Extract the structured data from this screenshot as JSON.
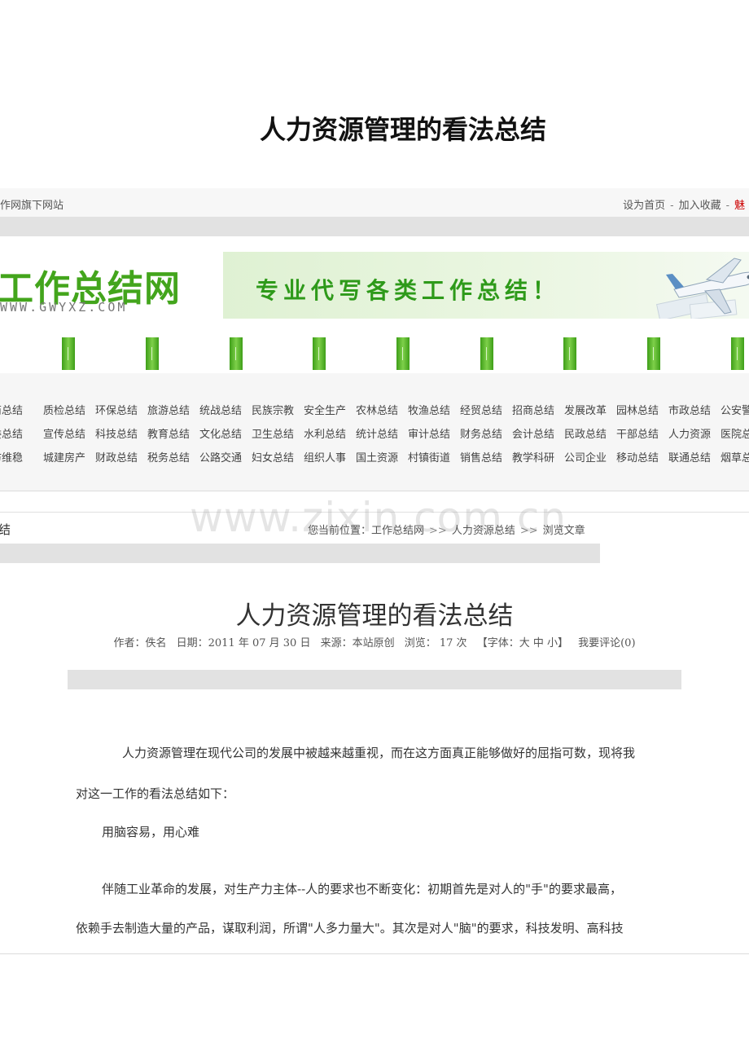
{
  "document_title": "人力资源管理的看法总结",
  "topbar": {
    "left_text": "作网旗下网站",
    "links": [
      "设为首页",
      "加入收藏"
    ],
    "separator": "-",
    "more_fragment": "魅"
  },
  "logo": {
    "name": "工作总结网",
    "url": "WWW.GWYXZ.COM"
  },
  "banner": {
    "text": "专业代写各类工作总结！",
    "icon": "airplane-icon"
  },
  "nav_tabs_count": 9,
  "categories": [
    [
      "商总结",
      "质检总结",
      "环保总结",
      "旅游总结",
      "统战总结",
      "民族宗教",
      "安全生产",
      "农林总结",
      "牧渔总结",
      "经贸总结",
      "招商总结",
      "发展改革",
      "园林总结",
      "市政总结",
      "公安警"
    ],
    [
      "委总结",
      "宣传总结",
      "科技总结",
      "教育总结",
      "文化总结",
      "卫生总结",
      "水利总结",
      "统计总结",
      "审计总结",
      "财务总结",
      "会计总结",
      "民政总结",
      "干部总结",
      "人力资源",
      "医院总"
    ],
    [
      "访维稳",
      "城建房产",
      "财政总结",
      "税务总结",
      "公路交通",
      "妇女总结",
      "组织人事",
      "国土资源",
      "村镇街道",
      "销售总结",
      "教学科研",
      "公司企业",
      "移动总结",
      "联通总结",
      "烟草总"
    ]
  ],
  "section_tag": "结",
  "breadcrumb": {
    "prefix": "您当前位置：",
    "items": [
      "工作总结网",
      "人力资源总结",
      "浏览文章"
    ],
    "separator": ">>"
  },
  "watermark": "www.zixin.com.cn",
  "article": {
    "title": "人力资源管理的看法总结",
    "meta": {
      "author": "作者：佚名",
      "date": "日期：2011 年 07 月 30 日",
      "source": "来源：本站原创",
      "views": "浏览：  17  次",
      "font_size": "【字体：大  中  小】",
      "comment": "我要评论(0)"
    },
    "paragraphs": [
      "人力资源管理在现代公司的发展中被越来越重视，而在这方面真正能够做好的屈指可数，现将我",
      "对这一工作的看法总结如下：",
      "用脑容易，用心难",
      "伴随工业革命的发展，对生产力主体--人的要求也不断变化：初期首先是对人的\"手\"的要求最高，",
      "依赖手去制造大量的产品，谋取利润，所谓\"人多力量大\"。其次是对人\"脑\"的要求，科技发明、高科技"
    ]
  },
  "colors": {
    "brand_green": "#43a51c",
    "tab_green": "#5cb82e",
    "strip_gray": "#e2e2e2",
    "more_red": "#cc0000"
  }
}
